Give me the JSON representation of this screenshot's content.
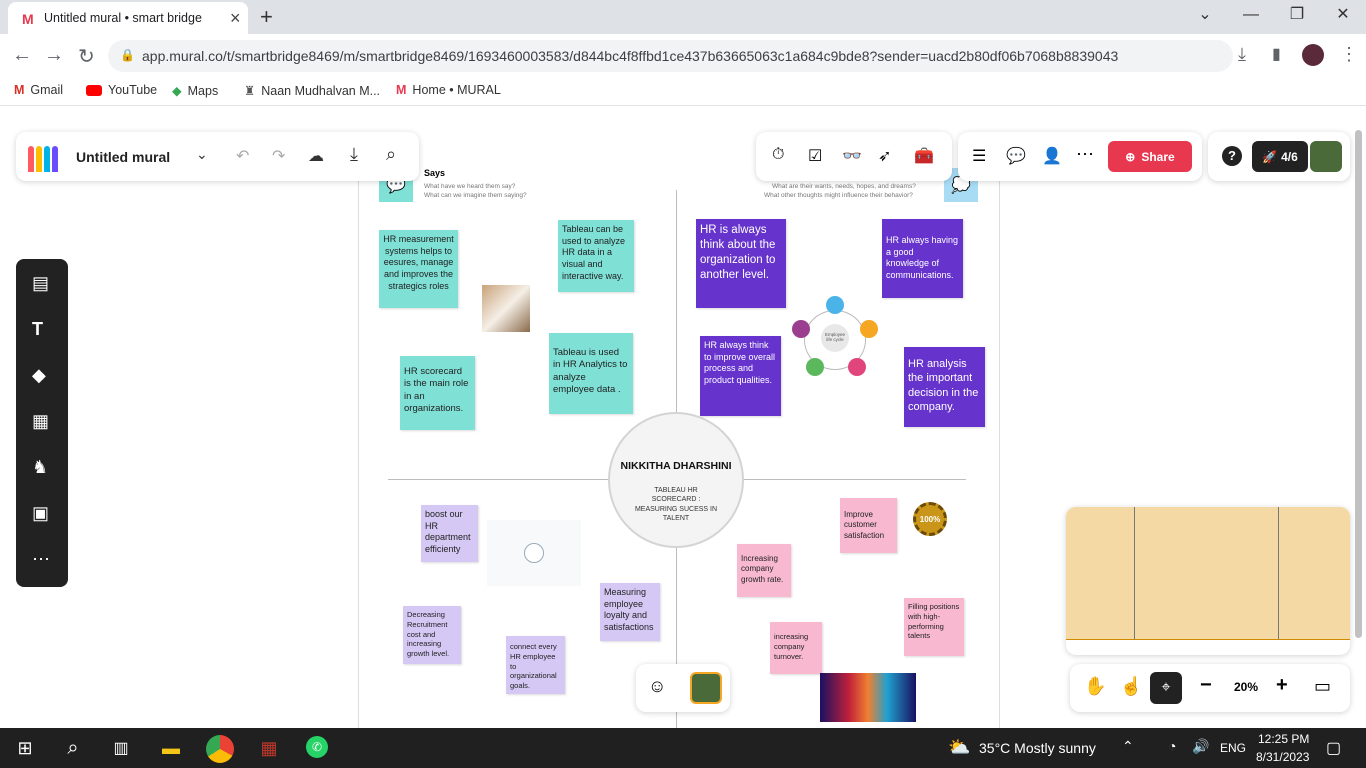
{
  "browser": {
    "tab_title": "Untitled mural • smart bridge",
    "url": "app.mural.co/t/smartbridge8469/m/smartbridge8469/1693460003583/d844bc4f8ffbd1ce437b63665063c1a684c9bde8?sender=uacd2b80df06b7068b8839043",
    "bookmarks": [
      "Gmail",
      "YouTube",
      "Maps",
      "Naan Mudhalvan M...",
      "Home • MURAL"
    ]
  },
  "mural": {
    "title": "Untitled mural",
    "share_label": "Share",
    "progress": "4/6",
    "zoom": "20%"
  },
  "board": {
    "says_title": "Says",
    "says_sub1": "What have we heard them say?",
    "says_sub2": "What can we imagine them saying?",
    "thinks_sub1": "What are their wants, needs, hopes, and dreams?",
    "thinks_sub2": "What other thoughts might influence their behavior?",
    "center_name": "NIKKITHA  DHARSHINI",
    "center_sub": "TABLEAU HR SCORECARD : MEASURING SUCESS IN TALENT",
    "notes": {
      "n1": "HR measurement systems helps to eesures, manage and improves the strategics roles",
      "n2": "Tableau can be used to analyze HR data in a visual and interactive way.",
      "n3": "HR scorecard is the main role in an organizations.",
      "n4": "Tableau is used in HR Analytics to analyze employee data .",
      "n5": "HR is always think about the organization to another level.",
      "n6": "HR always having a good knowledge of communications.",
      "n7": "HR always think to improve overall process and product qualities.",
      "n8": "HR analysis the important decision in the company.",
      "n9": "boost our HR department efficienty",
      "n10": "Measuring employee loyalty and satisfactions",
      "n11": "Decreasing Recruitment cost and increasing growth level.",
      "n12": "connect every HR employee to organizational goals.",
      "n13": "Improve customer satisfaction",
      "n14": "Increasing company growth rate.",
      "n15": "Filling positions with high-performing talents",
      "n16": "increasing company turnover."
    },
    "cycle_center": "Employee life cycle",
    "badge_text": "100%"
  },
  "taskbar": {
    "weather": "35°C  Mostly sunny",
    "lang": "ENG",
    "time": "12:25 PM",
    "date": "8/31/2023"
  },
  "colors": {
    "mural_red": "#e8384f",
    "teal": "#7fe0d6",
    "purple": "#6633cc",
    "lavender": "#d6c8f5",
    "pink": "#f7b8d0"
  }
}
